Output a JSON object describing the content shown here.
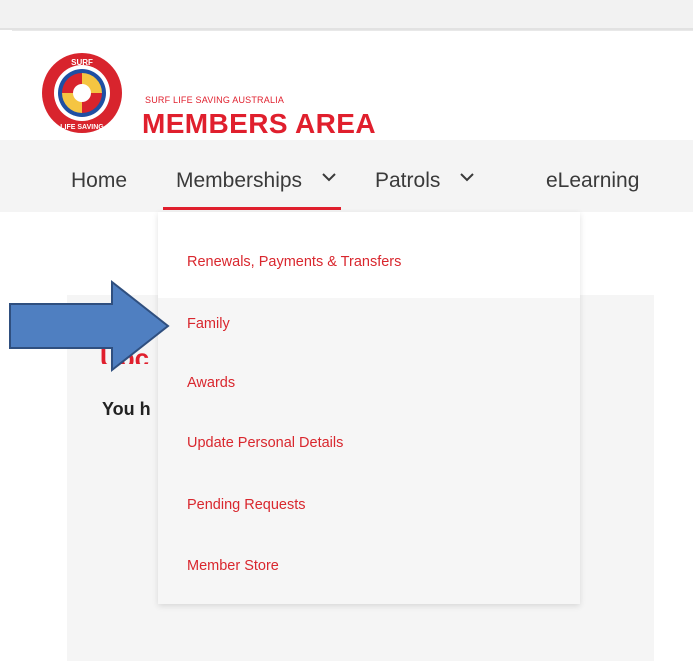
{
  "brand": {
    "small_text": "SURF LIFE SAVING AUSTRALIA",
    "large_text": "MEMBERS AREA",
    "logo_icon": "surf-life-saving-logo-icon",
    "accent_color": "#e01f2d"
  },
  "nav": {
    "items": [
      {
        "label": "Home",
        "has_dropdown": false
      },
      {
        "label": "Memberships",
        "has_dropdown": true,
        "active": true
      },
      {
        "label": "Patrols",
        "has_dropdown": true
      },
      {
        "label": "eLearning",
        "has_dropdown": false
      }
    ]
  },
  "dropdown": {
    "items": [
      {
        "label": "Renewals, Payments & Transfers"
      },
      {
        "label": "Family"
      },
      {
        "label": "Awards"
      },
      {
        "label": "Update Personal Details"
      },
      {
        "label": "Pending Requests"
      },
      {
        "label": "Member Store"
      }
    ]
  },
  "content": {
    "title_partial": "Upc",
    "text_partial": "You h"
  },
  "annotation": {
    "arrow_icon": "right-arrow-icon",
    "arrow_color": "#4f7fc1",
    "points_to": "Family"
  }
}
